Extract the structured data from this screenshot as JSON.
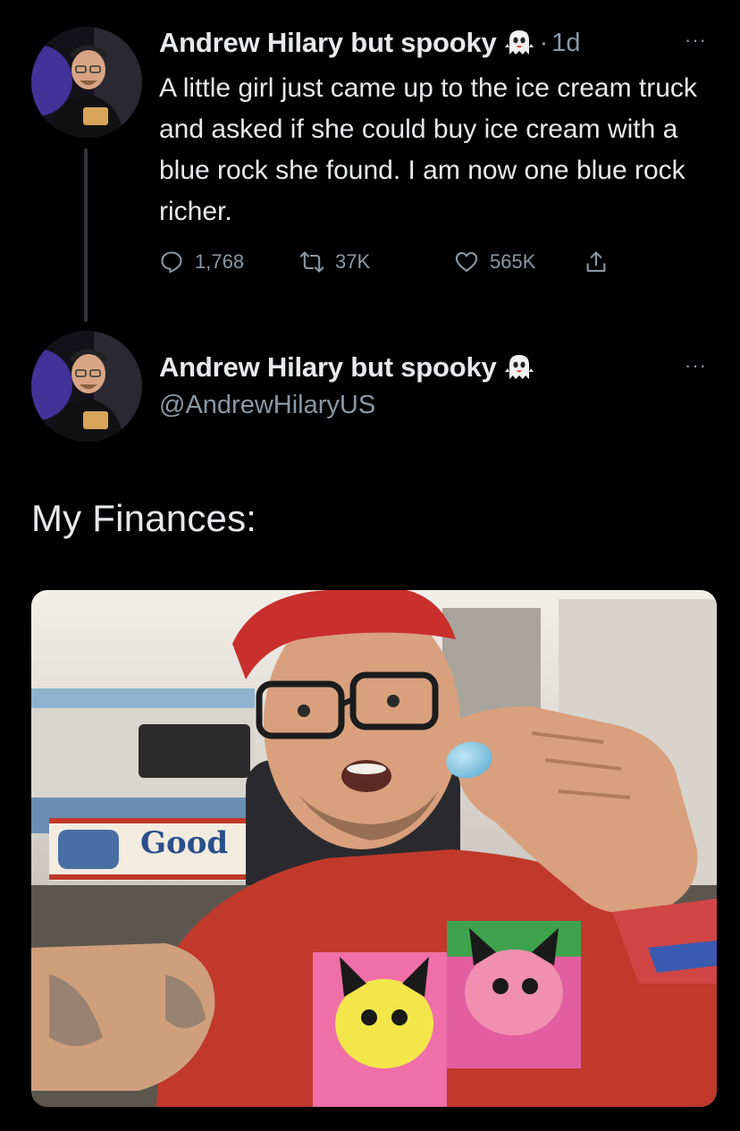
{
  "tweet": {
    "display_name": "Andrew Hilary but spooky",
    "separator": "·",
    "time": "1d",
    "more": "···",
    "text": "A little girl just came up to the ice cream truck and asked if she could buy ice cream with a blue rock she found. I am now one blue rock richer.",
    "stats": {
      "replies": "1,768",
      "retweets": "37K",
      "likes": "565K"
    }
  },
  "reply": {
    "display_name": "Andrew Hilary but spooky",
    "handle": "@AndrewHilaryUS",
    "more": "···",
    "text": "My Finances:",
    "photo_sign": "Good"
  },
  "icons": {
    "name_badge": "ghost-emoji-icon",
    "reply": "reply-icon",
    "retweet": "retweet-icon",
    "like": "heart-icon",
    "share": "share-icon"
  },
  "colors": {
    "background": "#000000",
    "text": "#e7e9ea",
    "secondary_text": "#8b98a5",
    "thread_line": "#333639"
  }
}
